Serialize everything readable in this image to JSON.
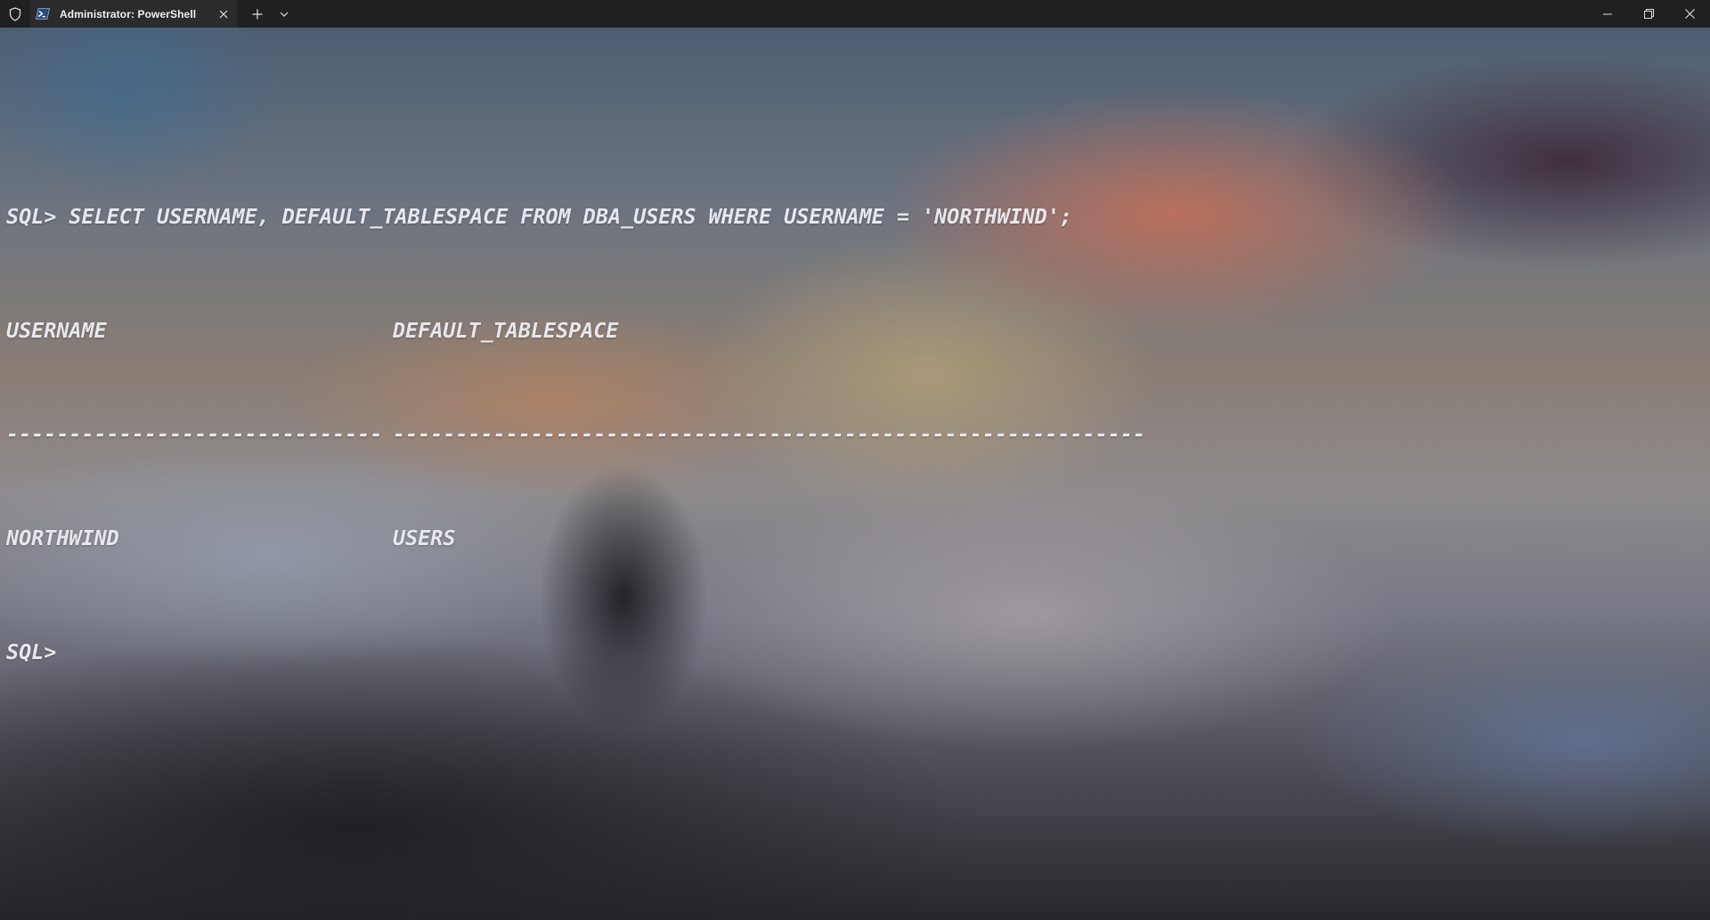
{
  "titlebar": {
    "tab_title": "Administrator: PowerShell",
    "icons": {
      "admin": "shield-icon",
      "app": "powershell-icon",
      "close_tab": "close-icon",
      "new_tab": "plus-icon",
      "dropdown": "chevron-down-icon",
      "minimize": "minimize-icon",
      "maximize": "restore-icon",
      "close_window": "close-icon"
    }
  },
  "terminal": {
    "command_line": "SQL> SELECT USERNAME, DEFAULT_TABLESPACE FROM DBA_USERS WHERE USERNAME = 'NORTHWIND';",
    "columns": [
      "USERNAME",
      "DEFAULT_TABLESPACE"
    ],
    "separators": [
      "------------------------------",
      "------------------------------------------------------------"
    ],
    "rows": [
      [
        "NORTHWIND",
        "USERS"
      ]
    ],
    "prompt": "SQL>"
  },
  "colors": {
    "titlebar_bg": "#202020",
    "tab_bg": "#2b2b2b",
    "terminal_text": "#e6e7ec"
  }
}
